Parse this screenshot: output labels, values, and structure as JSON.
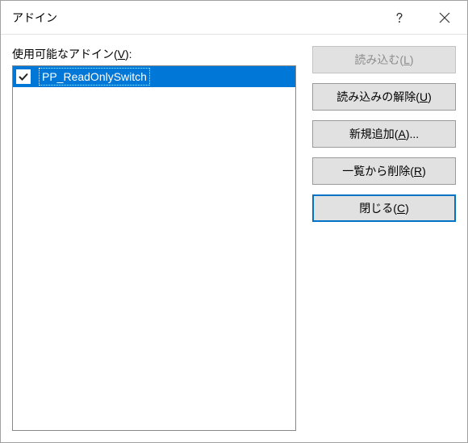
{
  "title": "アドイン",
  "help_icon": "help-icon",
  "close_icon": "close-icon",
  "list": {
    "label_pre": "使用可能なアドイン(",
    "label_mn": "V",
    "label_post": "):",
    "items": [
      {
        "name": "PP_ReadOnlySwitch",
        "checked": true,
        "selected": true
      }
    ]
  },
  "buttons": {
    "load": {
      "pre": "読み込む(",
      "mn": "L",
      "post": ")",
      "disabled": true
    },
    "unload": {
      "pre": "読み込みの解除(",
      "mn": "U",
      "post": ")",
      "disabled": false
    },
    "add": {
      "pre": "新規追加(",
      "mn": "A",
      "post": ")...",
      "disabled": false
    },
    "remove": {
      "pre": "一覧から削除(",
      "mn": "R",
      "post": ")",
      "disabled": false
    },
    "close": {
      "pre": "閉じる(",
      "mn": "C",
      "post": ")",
      "focused": true
    }
  }
}
